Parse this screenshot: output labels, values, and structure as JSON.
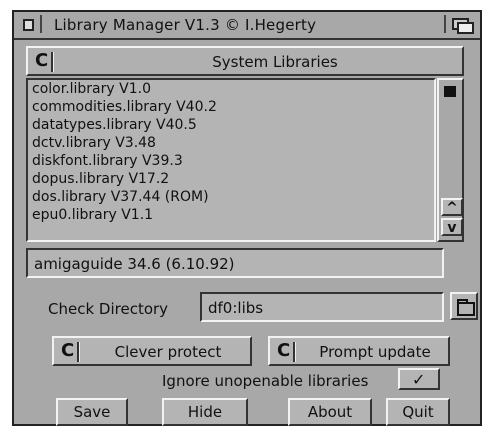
{
  "window": {
    "title": "Library Manager V1.3 © I.Hegerty"
  },
  "libraries": {
    "cycle_glyph": "C",
    "category": "System Libraries",
    "items": [
      "color.library V1.0",
      "commodities.library V40.2",
      "datatypes.library V40.5",
      "dctv.library V3.48",
      "diskfont.library V39.3",
      "dopus.library V17.2",
      "dos.library V37.44 (ROM)",
      "epu0.library V1.1"
    ],
    "scroll_up": "^",
    "scroll_down": "v"
  },
  "status": {
    "text": "amigaguide 34.6 (6.10.92)"
  },
  "check_directory": {
    "label": "Check Directory",
    "value": "df0:libs"
  },
  "modes": [
    {
      "glyph": "C",
      "label": "Clever protect"
    },
    {
      "glyph": "C",
      "label": "Prompt update"
    }
  ],
  "ignore": {
    "label": "Ignore unopenable libraries",
    "checked": true,
    "mark": "✓"
  },
  "buttons": {
    "save": "Save",
    "hide": "Hide",
    "about": "About",
    "quit": "Quit"
  }
}
